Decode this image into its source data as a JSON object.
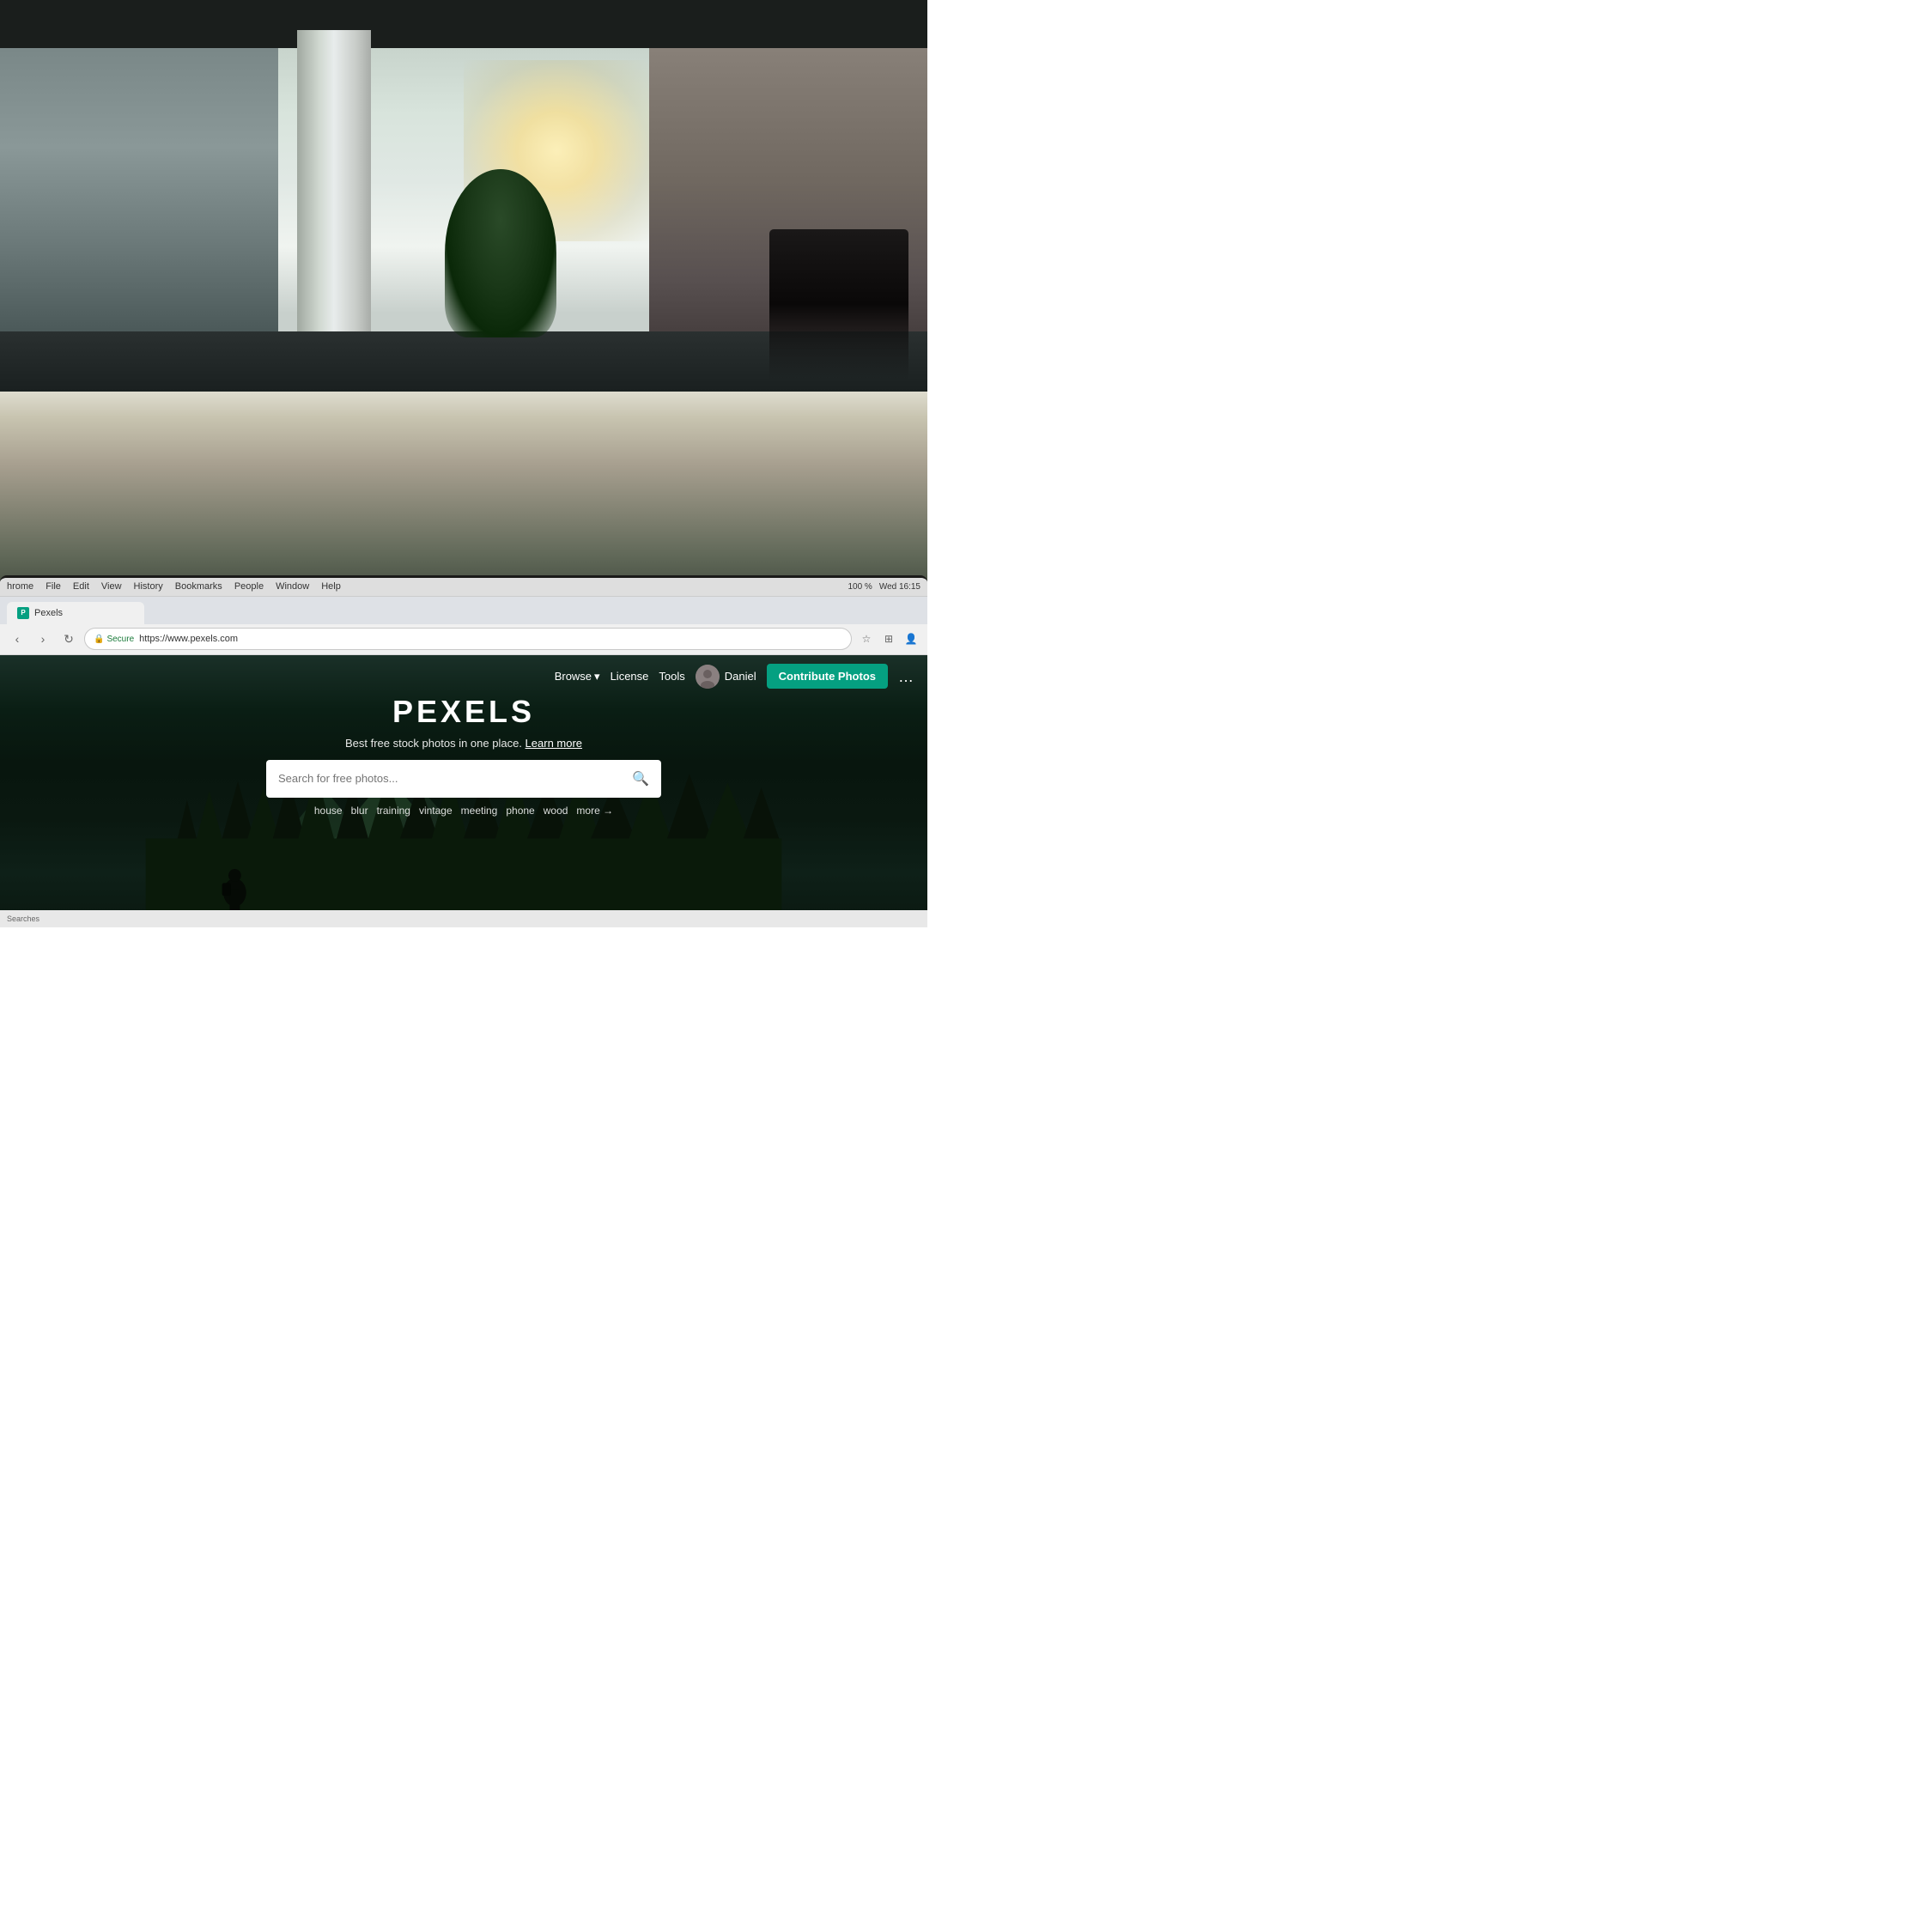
{
  "background": {
    "alt": "Office space background photo with blurred interior"
  },
  "system": {
    "time": "Wed 16:15",
    "battery": "100 %",
    "wifi": "on"
  },
  "browser": {
    "menu_items": [
      "hrome",
      "File",
      "Edit",
      "View",
      "History",
      "Bookmarks",
      "People",
      "Window",
      "Help"
    ],
    "tab_title": "Pexels",
    "secure_label": "Secure",
    "url": "https://www.pexels.com",
    "nav_back": "‹",
    "nav_forward": "›",
    "nav_refresh": "↻"
  },
  "website": {
    "name": "PEXELS",
    "tagline": "Best free stock photos in one place.",
    "tagline_link": "Learn more",
    "nav": {
      "browse": "Browse",
      "license": "License",
      "tools": "Tools",
      "user": "Daniel",
      "contribute": "Contribute Photos",
      "more": "…"
    },
    "search": {
      "placeholder": "Search for free photos...",
      "icon": "🔍"
    },
    "suggestions": [
      "house",
      "blur",
      "training",
      "vintage",
      "meeting",
      "phone",
      "wood",
      "more →"
    ]
  },
  "statusbar": {
    "text": "Searches"
  }
}
